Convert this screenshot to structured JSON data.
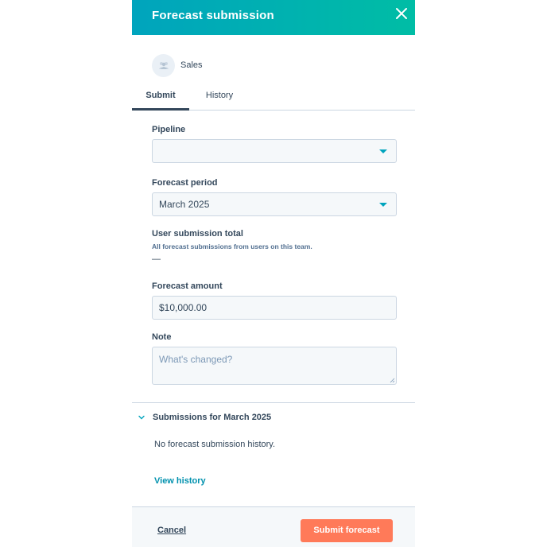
{
  "header": {
    "title": "Forecast submission"
  },
  "team": {
    "name": "Sales"
  },
  "tabs": [
    {
      "label": "Submit",
      "active": true
    },
    {
      "label": "History",
      "active": false
    }
  ],
  "form": {
    "pipeline": {
      "label": "Pipeline",
      "value": ""
    },
    "forecast_period": {
      "label": "Forecast period",
      "value": "March 2025"
    },
    "user_submission_total": {
      "label": "User submission total",
      "help": "All forecast submissions from users on this team.",
      "value": "—"
    },
    "forecast_amount": {
      "label": "Forecast amount",
      "value": "$10,000.00"
    },
    "note": {
      "label": "Note",
      "placeholder": "What's changed?"
    }
  },
  "submissions": {
    "title": "Submissions for March 2025",
    "empty_text": "No forecast submission history.",
    "view_history_label": "View history"
  },
  "footer": {
    "cancel_label": "Cancel",
    "submit_label": "Submit forecast"
  },
  "colors": {
    "header_gradient_start": "#00a4bd",
    "header_gradient_end": "#00bda5",
    "accent": "#00a4bd",
    "link": "#0091ae",
    "primary_button": "#ff7a59",
    "text": "#33475b"
  },
  "icons": {
    "close": "close-icon",
    "team": "team-icon",
    "dropdown": "chevron-down-icon",
    "collapse": "chevron-down-icon"
  }
}
